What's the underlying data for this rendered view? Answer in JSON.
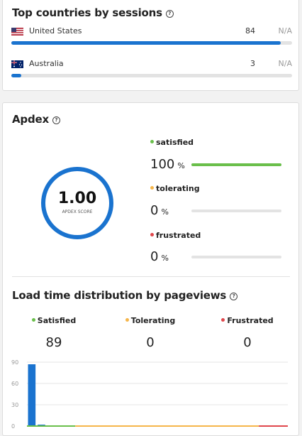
{
  "countries_card": {
    "title": "Top countries by sessions",
    "rows": [
      {
        "name": "United States",
        "value": "84",
        "na": "N/A",
        "fraction": 0.96,
        "flag": "us-flag"
      },
      {
        "name": "Australia",
        "value": "3",
        "na": "N/A",
        "fraction": 0.035,
        "flag": "au-flag"
      }
    ]
  },
  "apdex_card": {
    "title": "Apdex",
    "score": "1.00",
    "score_label": "APDEX SCORE",
    "metrics": [
      {
        "label": "satisfied",
        "value": "100",
        "unit": "%",
        "fraction": 1.0,
        "color": "#6abf4b"
      },
      {
        "label": "tolerating",
        "value": "0",
        "unit": "%",
        "fraction": 0.0,
        "color": "#f5b54a"
      },
      {
        "label": "frustrated",
        "value": "0",
        "unit": "%",
        "fraction": 0.0,
        "color": "#e0474c"
      }
    ]
  },
  "load_time": {
    "title": "Load time distribution by pageviews",
    "columns": [
      {
        "label": "Satisfied",
        "value": "89",
        "color": "#6abf4b"
      },
      {
        "label": "Tolerating",
        "value": "0",
        "color": "#f5b54a"
      },
      {
        "label": "Frustrated",
        "value": "0",
        "color": "#e0474c"
      }
    ]
  },
  "colors": {
    "accent": "#1a73cf",
    "satisfied": "#6abf4b",
    "tolerating": "#f5b54a",
    "frustrated": "#e0474c"
  },
  "chart_data": {
    "type": "bar",
    "x": [
      1,
      2,
      3,
      4,
      5,
      6,
      7,
      8,
      9,
      10,
      11,
      12,
      13,
      14,
      15,
      16,
      17,
      18,
      19,
      20,
      21,
      22,
      23,
      24,
      25,
      26,
      27
    ],
    "values": [
      87,
      2,
      0,
      0,
      0,
      0,
      0,
      0,
      0,
      0,
      0,
      0,
      0,
      0,
      0,
      0,
      0,
      0,
      0,
      0,
      0,
      0,
      0,
      0,
      0,
      0,
      0
    ],
    "ylim": [
      0,
      90
    ],
    "yticks": [
      0,
      30,
      60,
      90
    ],
    "bands": [
      {
        "name": "Satisfied",
        "from": 1,
        "to": 6,
        "color": "#6abf4b"
      },
      {
        "name": "Tolerating",
        "from": 6,
        "to": 25,
        "color": "#f5b54a"
      },
      {
        "name": "Frustrated",
        "from": 25,
        "to": 27,
        "color": "#e0474c"
      }
    ],
    "grid": true
  }
}
